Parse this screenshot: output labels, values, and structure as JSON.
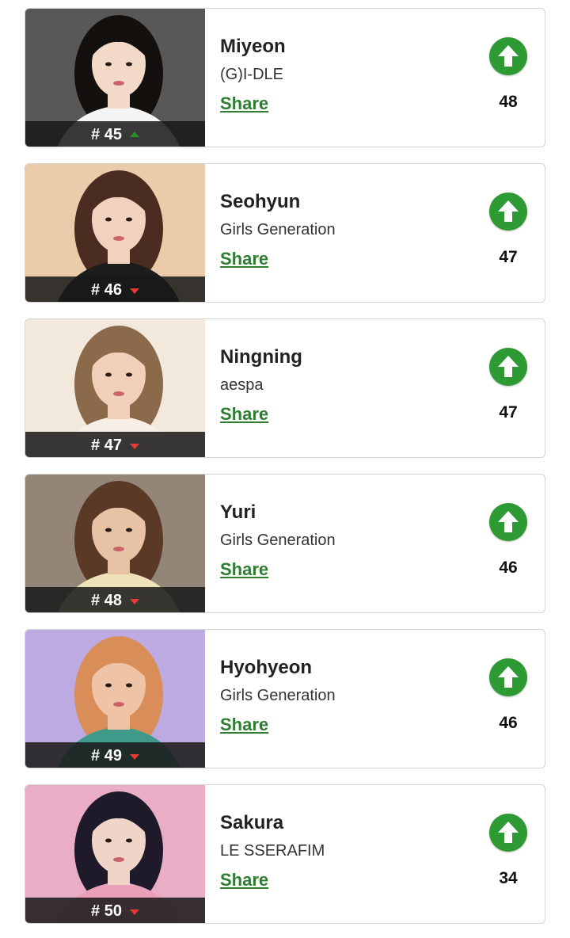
{
  "ranking": {
    "items": [
      {
        "name": "Miyeon",
        "group": "(G)I-DLE",
        "rank": "# 45",
        "trend": "up",
        "share_label": "Share",
        "votes": "48",
        "photo_colors": {
          "bg": "#4a4a4a",
          "hair": "#14100e",
          "skin": "#f3d9c8",
          "top": "#f5f5f5"
        }
      },
      {
        "name": "Seohyun",
        "group": "Girls Generation",
        "rank": "# 46",
        "trend": "down",
        "share_label": "Share",
        "votes": "47",
        "photo_colors": {
          "bg": "#e9c7a3",
          "hair": "#4a2c20",
          "skin": "#f1d2bf",
          "top": "#1c1c1c"
        }
      },
      {
        "name": "Ningning",
        "group": "aespa",
        "rank": "# 47",
        "trend": "down",
        "share_label": "Share",
        "votes": "47",
        "photo_colors": {
          "bg": "#f2e6da",
          "hair": "#8a6a4a",
          "skin": "#f0d0b8",
          "top": "#f7efe6"
        }
      },
      {
        "name": "Yuri",
        "group": "Girls Generation",
        "rank": "# 48",
        "trend": "down",
        "share_label": "Share",
        "votes": "46",
        "photo_colors": {
          "bg": "#8b7b6e",
          "hair": "#5a3a26",
          "skin": "#e8c2a4",
          "top": "#efe2b8"
        }
      },
      {
        "name": "Hyohyeon",
        "group": "Girls Generation",
        "rank": "# 49",
        "trend": "down",
        "share_label": "Share",
        "votes": "46",
        "photo_colors": {
          "bg": "#b9a3e0",
          "hair": "#d98e5a",
          "skin": "#efc4a6",
          "top": "#3f9a8a"
        }
      },
      {
        "name": "Sakura",
        "group": "LE SSERAFIM",
        "rank": "# 50",
        "trend": "down",
        "share_label": "Share",
        "votes": "34",
        "photo_colors": {
          "bg": "#e8a6c2",
          "hair": "#1e1a2a",
          "skin": "#f0d4c8",
          "top": "#e9a0b8"
        }
      }
    ]
  }
}
